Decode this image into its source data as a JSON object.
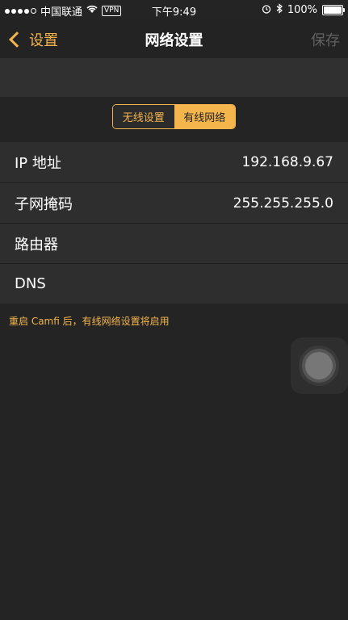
{
  "status": {
    "carrier": "中国联通",
    "vpn": "VPN",
    "time": "下午9:49",
    "battery": "100%"
  },
  "nav": {
    "back_label": "设置",
    "title": "网络设置",
    "save_label": "保存"
  },
  "segments": [
    {
      "label": "无线设置",
      "selected": false
    },
    {
      "label": "有线网络",
      "selected": true
    }
  ],
  "rows": [
    {
      "label": "IP 地址",
      "value": "192.168.9.67"
    },
    {
      "label": "子网掩码",
      "value": "255.255.255.0"
    },
    {
      "label": "路由器",
      "value": ""
    },
    {
      "label": "DNS",
      "value": ""
    }
  ],
  "note": "重启 Camfi 后，有线网络设置将启用",
  "colors": {
    "accent": "#f4b54c",
    "background": "#242424",
    "row": "#2e2e2e"
  }
}
